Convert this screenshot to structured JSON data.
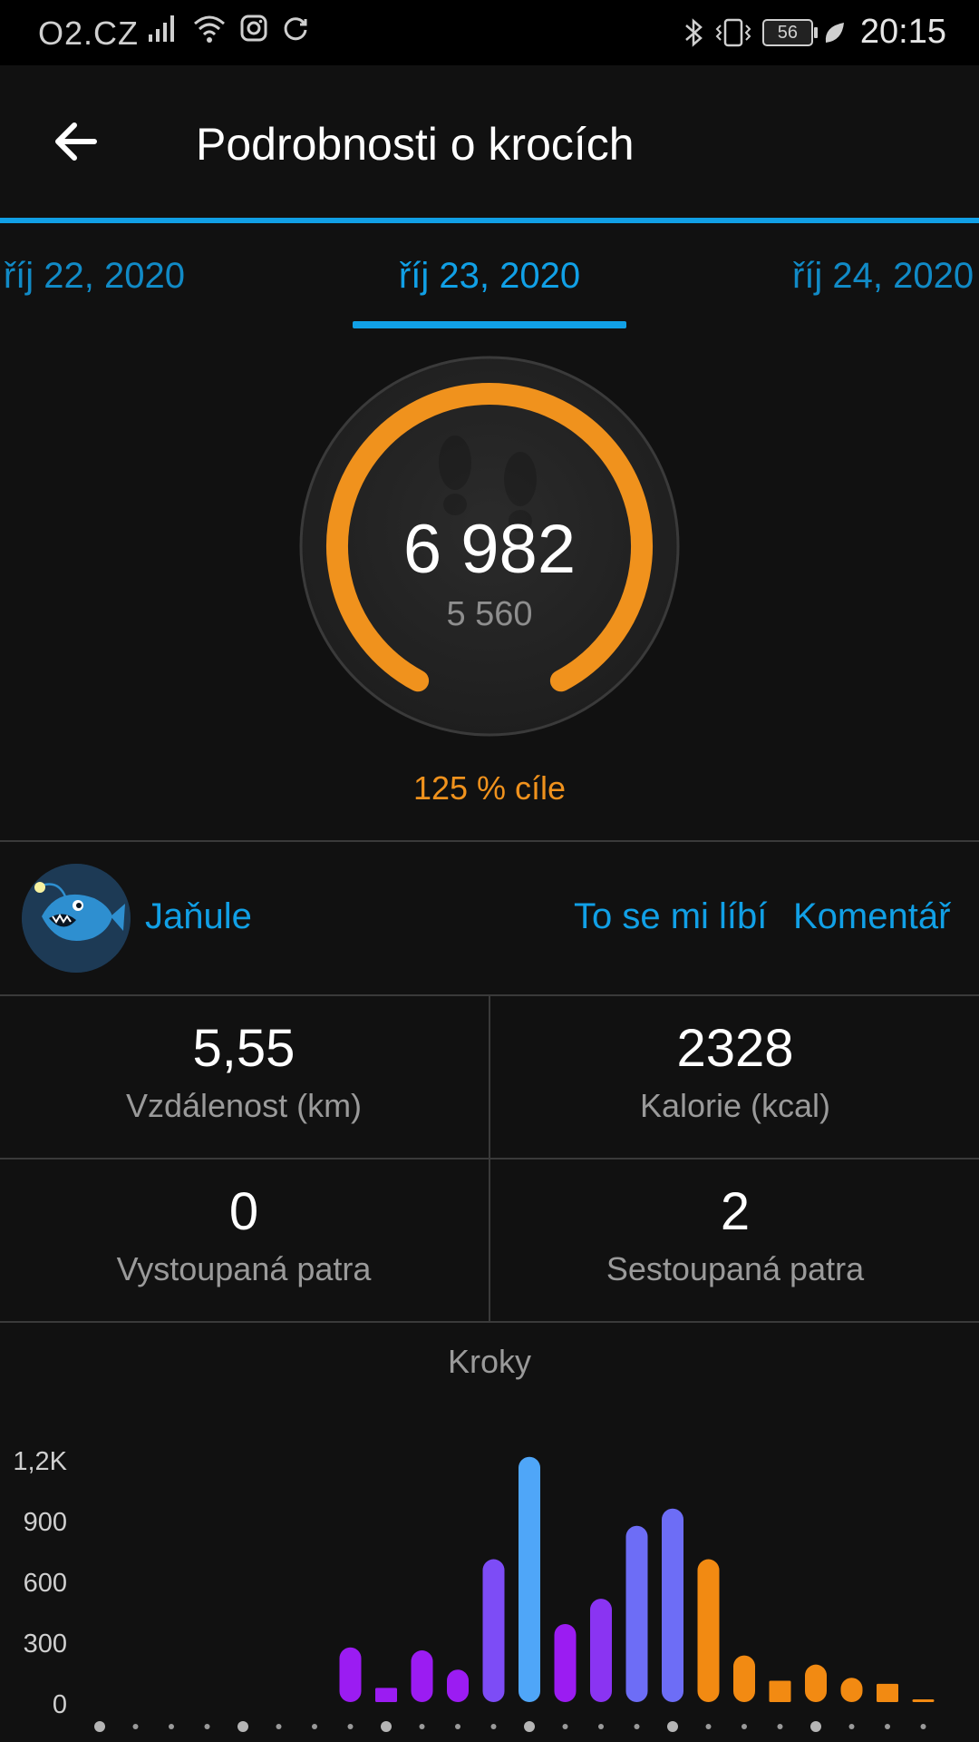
{
  "status_bar": {
    "carrier": "O2.CZ",
    "battery": "56",
    "time": "20:15"
  },
  "header": {
    "title": "Podrobnosti o krocích"
  },
  "date_tabs": {
    "prev": "říj 22, 2020",
    "current": "říj 23, 2020",
    "next": "říj 24, 2020"
  },
  "summary": {
    "steps": "6 982",
    "goal": "5 560",
    "goal_percent": "125 % cíle",
    "progress": 1.0
  },
  "social": {
    "username": "Jaňule",
    "like_label": "To se mi líbí",
    "comment_label": "Komentář"
  },
  "stats": {
    "distance": {
      "value": "5,55",
      "label": "Vzdálenost (km)"
    },
    "calories": {
      "value": "2328",
      "label": "Kalorie (kcal)"
    },
    "floors_up": {
      "value": "0",
      "label": "Vystoupaná patra"
    },
    "floors_down": {
      "value": "2",
      "label": "Sestoupaná patra"
    }
  },
  "chart_data": {
    "type": "bar",
    "title": "Kroky",
    "ylim": [
      0,
      1200
    ],
    "y_ticks": [
      "0",
      "300",
      "600",
      "900",
      "1,2K"
    ],
    "y_tick_values": [
      0,
      300,
      600,
      900,
      1200
    ],
    "values": [
      0,
      0,
      0,
      0,
      0,
      0,
      0,
      270,
      70,
      255,
      160,
      705,
      1210,
      385,
      510,
      870,
      955,
      705,
      230,
      105,
      185,
      120,
      90,
      10
    ],
    "colors": [
      "#9b1cf2",
      "#9b1cf2",
      "#9b1cf2",
      "#9b1cf2",
      "#9b1cf2",
      "#9b1cf2",
      "#9b1cf2",
      "#9b1cf2",
      "#9b1cf2",
      "#9b1cf2",
      "#9b1cf2",
      "#7d4cf6",
      "#4fa6f8",
      "#9b1cf2",
      "#8a34f2",
      "#6d6df6",
      "#6d6df6",
      "#f28a12",
      "#f28a12",
      "#f28a12",
      "#f28a12",
      "#f28a12",
      "#f28a12",
      "#f28a12"
    ],
    "grid": false
  },
  "colors": {
    "accent": "#11a0e6",
    "gauge": "#f0921d",
    "background": "#111111"
  }
}
